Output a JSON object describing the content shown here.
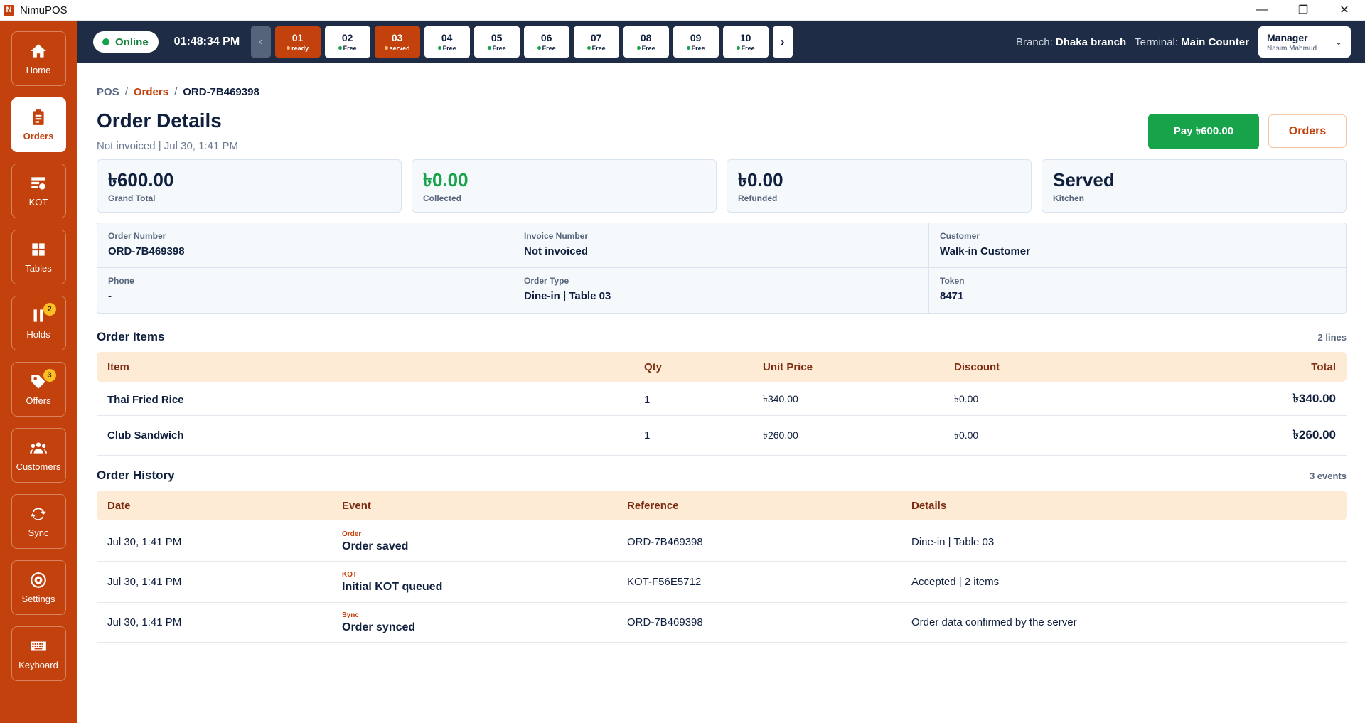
{
  "app": {
    "logo": "N",
    "title": "NimuPOS"
  },
  "window_controls": {
    "minimize": "—",
    "restore": "❐",
    "close": "✕"
  },
  "sidebar": {
    "items": [
      {
        "label": "Home",
        "icon": "home-icon",
        "active": false
      },
      {
        "label": "Orders",
        "icon": "orders-icon",
        "active": true
      },
      {
        "label": "KOT",
        "icon": "kot-icon",
        "active": false
      },
      {
        "label": "Tables",
        "icon": "tables-icon",
        "active": false
      },
      {
        "label": "Holds",
        "icon": "pause-icon",
        "active": false,
        "badge": "2"
      },
      {
        "label": "Offers",
        "icon": "tag-icon",
        "active": false,
        "badge": "3"
      },
      {
        "label": "Customers",
        "icon": "customers-icon",
        "active": false
      },
      {
        "label": "Sync",
        "icon": "sync-icon",
        "active": false
      },
      {
        "label": "Settings",
        "icon": "settings-icon",
        "active": false
      },
      {
        "label": "Keyboard",
        "icon": "keyboard-icon",
        "active": false
      }
    ]
  },
  "topbar": {
    "status": "Online",
    "clock": "01:48:34 PM",
    "prev_icon": "‹",
    "next_icon": "›",
    "tables": [
      {
        "num": "01",
        "status": "ready",
        "busy": true
      },
      {
        "num": "02",
        "status": "Free",
        "busy": false
      },
      {
        "num": "03",
        "status": "served",
        "busy": true
      },
      {
        "num": "04",
        "status": "Free",
        "busy": false
      },
      {
        "num": "05",
        "status": "Free",
        "busy": false
      },
      {
        "num": "06",
        "status": "Free",
        "busy": false
      },
      {
        "num": "07",
        "status": "Free",
        "busy": false
      },
      {
        "num": "08",
        "status": "Free",
        "busy": false
      },
      {
        "num": "09",
        "status": "Free",
        "busy": false
      },
      {
        "num": "10",
        "status": "Free",
        "busy": false
      }
    ],
    "branch_label": "Branch:",
    "branch_value": "Dhaka branch",
    "terminal_label": "Terminal:",
    "terminal_value": "Main Counter",
    "user_role": "Manager",
    "user_name": "Nasim Mahmud",
    "user_chevron": "⌄"
  },
  "breadcrumb": {
    "root": "POS",
    "sep": "/",
    "section": "Orders",
    "current": "ORD-7B469398"
  },
  "page": {
    "title": "Order Details",
    "subtitle": "Not invoiced | Jul 30, 1:41 PM",
    "pay_button": "Pay ৳600.00",
    "orders_button": "Orders"
  },
  "stats": [
    {
      "value": "৳600.00",
      "label": "Grand Total",
      "color": "#0f1f3d"
    },
    {
      "value": "৳0.00",
      "label": "Collected",
      "color": "#16a34a"
    },
    {
      "value": "৳0.00",
      "label": "Refunded",
      "color": "#0f1f3d"
    },
    {
      "value": "Served",
      "label": "Kitchen",
      "color": "#0f1f3d"
    }
  ],
  "info": [
    {
      "label": "Order Number",
      "value": "ORD-7B469398"
    },
    {
      "label": "Invoice Number",
      "value": "Not invoiced"
    },
    {
      "label": "Customer",
      "value": "Walk-in Customer"
    },
    {
      "label": "Phone",
      "value": "-"
    },
    {
      "label": "Order Type",
      "value": "Dine-in | Table 03"
    },
    {
      "label": "Token",
      "value": "8471"
    }
  ],
  "order_items": {
    "title": "Order Items",
    "count": "2 lines",
    "headers": {
      "item": "Item",
      "qty": "Qty",
      "unit_price": "Unit Price",
      "discount": "Discount",
      "total": "Total"
    },
    "rows": [
      {
        "item": "Thai Fried Rice",
        "qty": "1",
        "unit_price": "৳340.00",
        "discount": "৳0.00",
        "total": "৳340.00"
      },
      {
        "item": "Club Sandwich",
        "qty": "1",
        "unit_price": "৳260.00",
        "discount": "৳0.00",
        "total": "৳260.00"
      }
    ]
  },
  "order_history": {
    "title": "Order History",
    "count": "3 events",
    "headers": {
      "date": "Date",
      "event": "Event",
      "reference": "Reference",
      "details": "Details"
    },
    "rows": [
      {
        "date": "Jul 30, 1:41 PM",
        "tag": "Order",
        "event": "Order saved",
        "reference": "ORD-7B469398",
        "details": "Dine-in | Table 03"
      },
      {
        "date": "Jul 30, 1:41 PM",
        "tag": "KOT",
        "event": "Initial KOT queued",
        "reference": "KOT-F56E5712",
        "details": "Accepted | 2 items"
      },
      {
        "date": "Jul 30, 1:41 PM",
        "tag": "Sync",
        "event": "Order synced",
        "reference": "ORD-7B469398",
        "details": "Order data confirmed by the server"
      }
    ]
  },
  "colors": {
    "brand": "#c2410c",
    "topbar": "#1e2d45",
    "success": "#16a34a",
    "table_header_bg": "#fdebd6"
  }
}
